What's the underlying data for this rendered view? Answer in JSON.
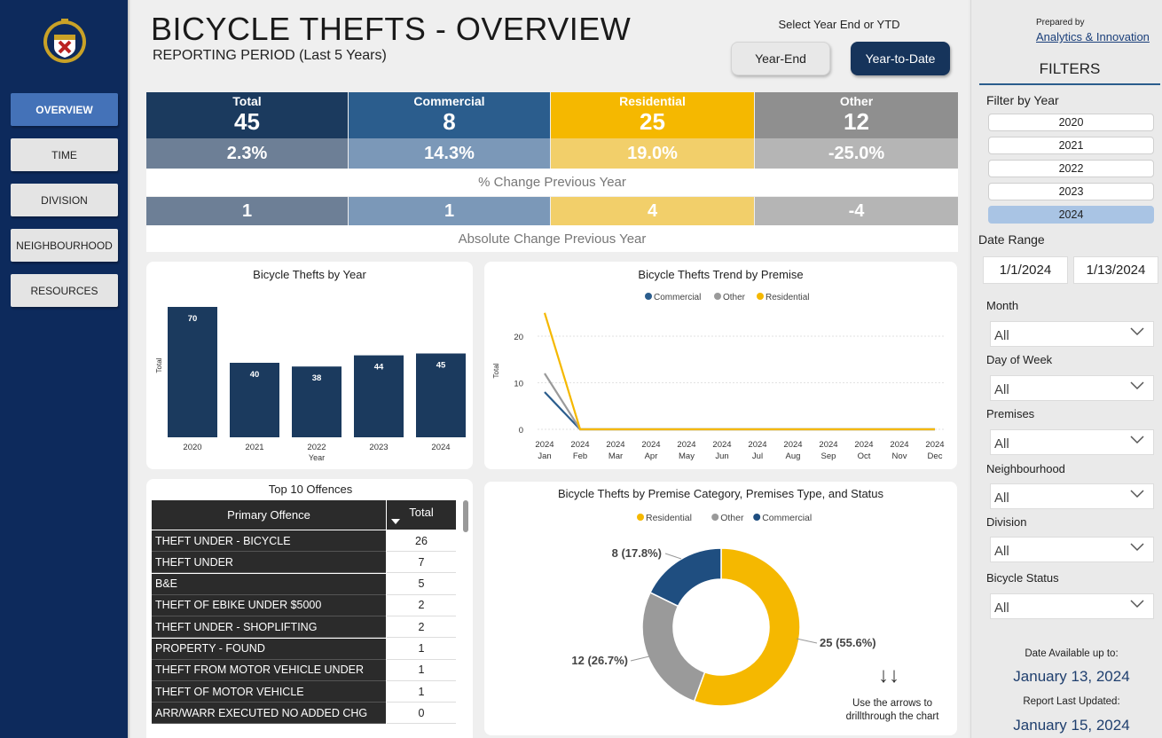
{
  "nav": {
    "items": [
      {
        "label": "OVERVIEW",
        "active": true
      },
      {
        "label": "TIME",
        "active": false
      },
      {
        "label": "DIVISION",
        "active": false
      },
      {
        "label": "NEIGHBOURHOOD",
        "active": false
      },
      {
        "label": "RESOURCES",
        "active": false
      }
    ]
  },
  "header": {
    "title": "BICYCLE THEFTS - OVERVIEW",
    "subtitle": "REPORTING PERIOD (Last 5 Years)",
    "select_label": "Select Year End or YTD",
    "year_end_label": "Year-End",
    "ytd_label": "Year-to-Date"
  },
  "kpi": {
    "columns": [
      {
        "label": "Total",
        "value": "45",
        "pct": "2.3%",
        "abs": "1",
        "color": "#1b3a5e",
        "light": "#6d7f96"
      },
      {
        "label": "Commercial",
        "value": "8",
        "pct": "14.3%",
        "abs": "1",
        "color": "#2b5d8d",
        "light": "#7b98b8"
      },
      {
        "label": "Residential",
        "value": "25",
        "pct": "19.0%",
        "abs": "4",
        "color": "#f5b800",
        "light": "#f2cf6a"
      },
      {
        "label": "Other",
        "value": "12",
        "pct": "-25.0%",
        "abs": "-4",
        "color": "#8f8f8f",
        "light": "#b5b5b5"
      }
    ],
    "pct_label": "% Change Previous Year",
    "abs_label": "Absolute Change Previous Year"
  },
  "bar_chart": {
    "title": "Bicycle Thefts by Year"
  },
  "line_chart": {
    "title": "Bicycle Thefts Trend by Premise"
  },
  "donut_chart": {
    "title": "Bicycle Thefts by Premise Category, Premises Type, and Status",
    "hint": "Use the arrows to drillthrough the chart",
    "arrows": "↓↓"
  },
  "top_offences": {
    "title": "Top 10 Offences",
    "col_name": "Primary Offence",
    "col_total": "Total",
    "rows": [
      {
        "name": "THEFT UNDER - BICYCLE",
        "total": "26"
      },
      {
        "name": "THEFT UNDER",
        "total": "7"
      },
      {
        "name": "B&E",
        "total": "5"
      },
      {
        "name": "THEFT OF EBIKE UNDER $5000",
        "total": "2"
      },
      {
        "name": "THEFT UNDER - SHOPLIFTING",
        "total": "2"
      },
      {
        "name": "PROPERTY - FOUND",
        "total": "1"
      },
      {
        "name": "THEFT FROM MOTOR VEHICLE UNDER",
        "total": "1"
      },
      {
        "name": "THEFT OF MOTOR VEHICLE",
        "total": "1"
      },
      {
        "name": "ARR/WARR EXECUTED NO ADDED CHG",
        "total": "0"
      }
    ]
  },
  "filters": {
    "prepared_by": "Prepared by",
    "prepared_link": "Analytics & Innovation",
    "heading": "FILTERS",
    "year_label": "Filter by Year",
    "years": [
      {
        "label": "2020",
        "selected": false
      },
      {
        "label": "2021",
        "selected": false
      },
      {
        "label": "2022",
        "selected": false
      },
      {
        "label": "2023",
        "selected": false
      },
      {
        "label": "2024",
        "selected": true
      }
    ],
    "date_range_label": "Date Range",
    "date_from": "1/1/2024",
    "date_to": "1/13/2024",
    "dropdowns": [
      {
        "label": "Month",
        "value": "All"
      },
      {
        "label": "Day of Week",
        "value": "All"
      },
      {
        "label": "Premises",
        "value": "All"
      },
      {
        "label": "Neighbourhood",
        "value": "All"
      },
      {
        "label": "Division",
        "value": "All"
      },
      {
        "label": "Bicycle Status",
        "value": "All"
      }
    ],
    "available_label": "Date Available up to:",
    "available_date": "January 13, 2024",
    "updated_label": "Report Last Updated:",
    "updated_date": "January 15, 2024"
  },
  "chart_data": [
    {
      "type": "bar",
      "title": "Bicycle Thefts by Year",
      "xlabel": "Year",
      "ylabel": "Total",
      "categories": [
        "2020",
        "2021",
        "2022",
        "2023",
        "2024"
      ],
      "values": [
        70,
        40,
        38,
        44,
        45
      ],
      "color": "#1b3a5e"
    },
    {
      "type": "line",
      "title": "Bicycle Thefts Trend by Premise",
      "ylabel": "Total",
      "x": [
        "2024 Jan",
        "2024 Feb",
        "2024 Mar",
        "2024 Apr",
        "2024 May",
        "2024 Jun",
        "2024 Jul",
        "2024 Aug",
        "2024 Sep",
        "2024 Oct",
        "2024 Nov",
        "2024 Dec"
      ],
      "ylim": [
        0,
        25
      ],
      "yticks": [
        0,
        10,
        20
      ],
      "legend_position": "top-center",
      "series": [
        {
          "name": "Commercial",
          "color": "#2b5d8d",
          "values": [
            8,
            0,
            0,
            0,
            0,
            0,
            0,
            0,
            0,
            0,
            0,
            0
          ]
        },
        {
          "name": "Other",
          "color": "#9a9a9a",
          "values": [
            12,
            0,
            0,
            0,
            0,
            0,
            0,
            0,
            0,
            0,
            0,
            0
          ]
        },
        {
          "name": "Residential",
          "color": "#f5b800",
          "values": [
            25,
            0,
            0,
            0,
            0,
            0,
            0,
            0,
            0,
            0,
            0,
            0
          ]
        }
      ]
    },
    {
      "type": "pie",
      "title": "Bicycle Thefts by Premise Category, Premises Type, and Status",
      "legend_position": "top-center",
      "slices": [
        {
          "name": "Residential",
          "value": 25,
          "label": "25 (55.6%)",
          "color": "#f5b800"
        },
        {
          "name": "Other",
          "value": 12,
          "label": "12 (26.7%)",
          "color": "#9a9a9a"
        },
        {
          "name": "Commercial",
          "value": 8,
          "label": "8 (17.8%)",
          "color": "#1f4e80"
        }
      ]
    }
  ]
}
